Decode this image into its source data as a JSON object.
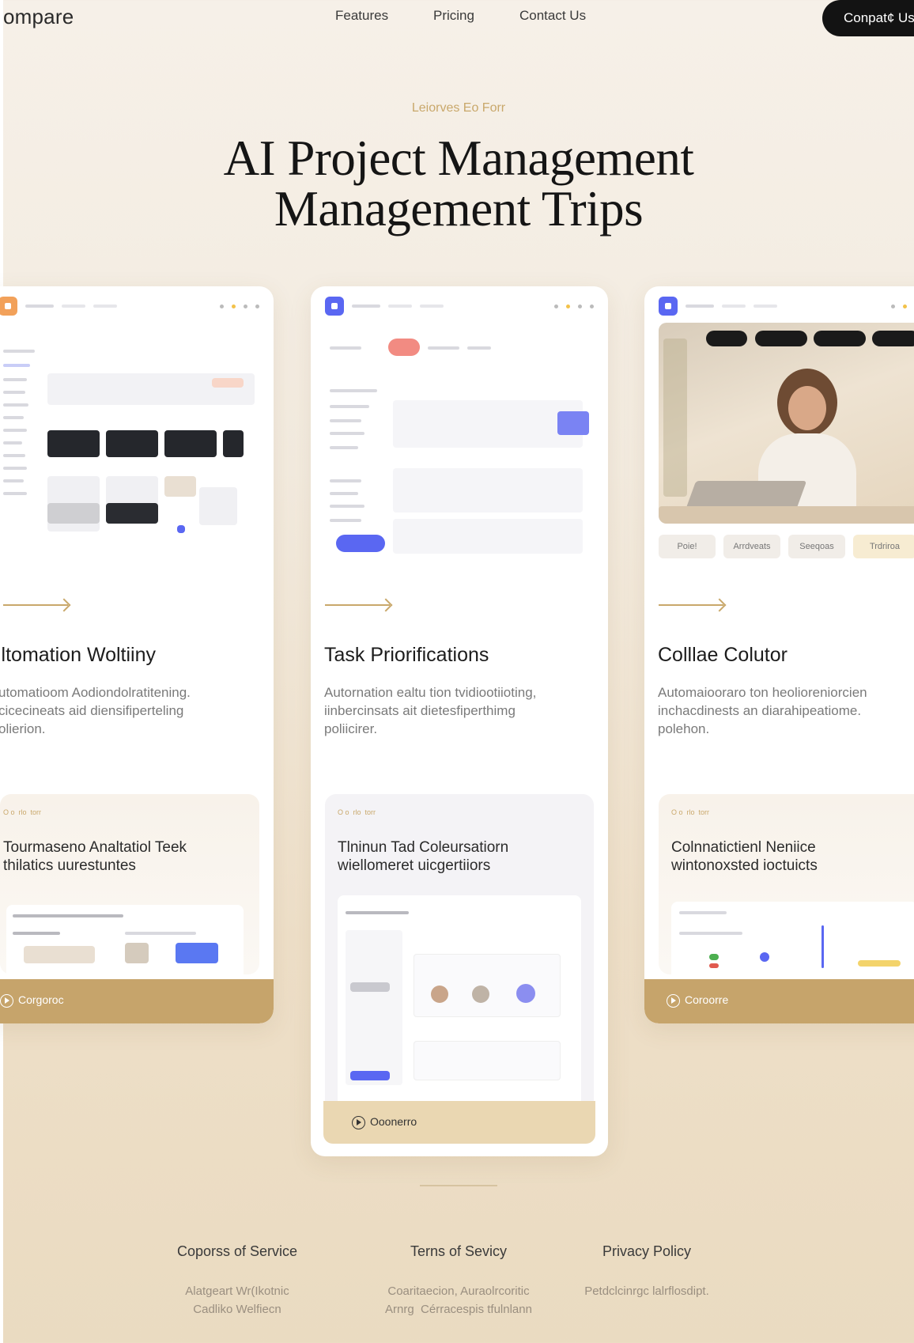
{
  "nav": {
    "brand": "ompare",
    "links": [
      "Features",
      "Pricing",
      "Contact Us"
    ],
    "cta": "Conpat¢ Us"
  },
  "hero": {
    "eyebrow": "Leiorves Eo Forr",
    "title_line1": "AI Project Management",
    "title_line2": "Management Trips"
  },
  "cards": [
    {
      "title": "lltomation Woltiiny",
      "desc": [
        "utomatioom Aodiondolratitening.",
        "cicecineats aid diensifiperteling",
        "olierion."
      ],
      "sub_tag": "O o  rlo  torr",
      "sub_title": [
        "Tourmaseno Analtatiol Teek",
        "thilatics uurestuntes"
      ],
      "footer": "Corgoroc"
    },
    {
      "title": "Task Priorifications",
      "desc": [
        "Autornation ealtu tion tvidiootiioting,",
        "iinbercinsats ait dietesfiperthimg",
        "poliicirer."
      ],
      "sub_tag": "O o  rlo  torr",
      "sub_title": [
        "Tlninun Tad Coleursatiorn",
        "wiellomeret uicgertiiors"
      ],
      "footer": "Ooonerro"
    },
    {
      "title": "Colllae Colutor",
      "desc": [
        "Automaiooraro ton heolioreniorcien",
        "inchacdinests an diarahipeatiome.",
        "polehon."
      ],
      "sub_tag": "O o  rlo  torr",
      "sub_title": [
        "Colnnatictienl Neniice",
        "wintonoxsted ioctuicts"
      ],
      "footer": "Coroorre",
      "tabs": [
        "Poie!",
        "Arrdveats",
        "Seeqoas",
        "Trdriroa"
      ]
    }
  ],
  "footer": {
    "columns": [
      {
        "title": "Coporss of Service",
        "lines": [
          "Alatgeart Wr(Ikotnic",
          "Cadliko Welfiecn"
        ]
      },
      {
        "title": "Terns of Sevicy",
        "lines": [
          "Coaritaecion, Auraolrcoritic",
          "Arnrg  Cérracespis tfulnlann"
        ]
      },
      {
        "title": "Privacy Policy",
        "lines": [
          "Petdclcinrgc lalrflosdipt."
        ]
      }
    ]
  },
  "colors": {
    "accent": "#c6a46b",
    "dark": "#131313",
    "mock_blue": "#5a67f2"
  }
}
